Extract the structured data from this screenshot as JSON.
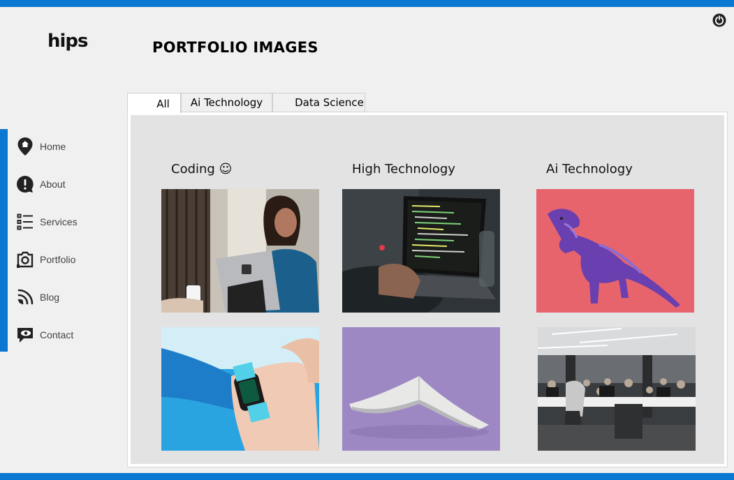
{
  "app": {
    "logo": "hips"
  },
  "header": {
    "title": "PORTFOLIO IMAGES"
  },
  "nav": {
    "items": [
      {
        "label": "Home",
        "icon": "map-pin-icon"
      },
      {
        "label": "About",
        "icon": "alert-icon"
      },
      {
        "label": "Services",
        "icon": "list-icon"
      },
      {
        "label": "Portfolio",
        "icon": "camera-icon"
      },
      {
        "label": "Blog",
        "icon": "feed-icon"
      },
      {
        "label": "Contact",
        "icon": "chat-eye-icon"
      }
    ]
  },
  "tabs": [
    {
      "label": "All",
      "active": true
    },
    {
      "label": "Ai Technology",
      "active": false
    },
    {
      "label": "Data Science",
      "active": false
    }
  ],
  "gallery": {
    "columns": [
      {
        "title": "Coding ☺"
      },
      {
        "title": "High Technology"
      },
      {
        "title": "Ai Technology"
      }
    ],
    "images": [
      {
        "icon": "woman-with-tablet-photo"
      },
      {
        "icon": "laptop-coding-photo"
      },
      {
        "icon": "purple-dinosaur-photo"
      },
      {
        "icon": "smartwatch-photo"
      },
      {
        "icon": "open-notebook-photo"
      },
      {
        "icon": "office-workspace-photo"
      }
    ]
  },
  "colors": {
    "accent": "#0a77d0",
    "panel": "#e3e3e3",
    "background": "#f0f0f0"
  }
}
